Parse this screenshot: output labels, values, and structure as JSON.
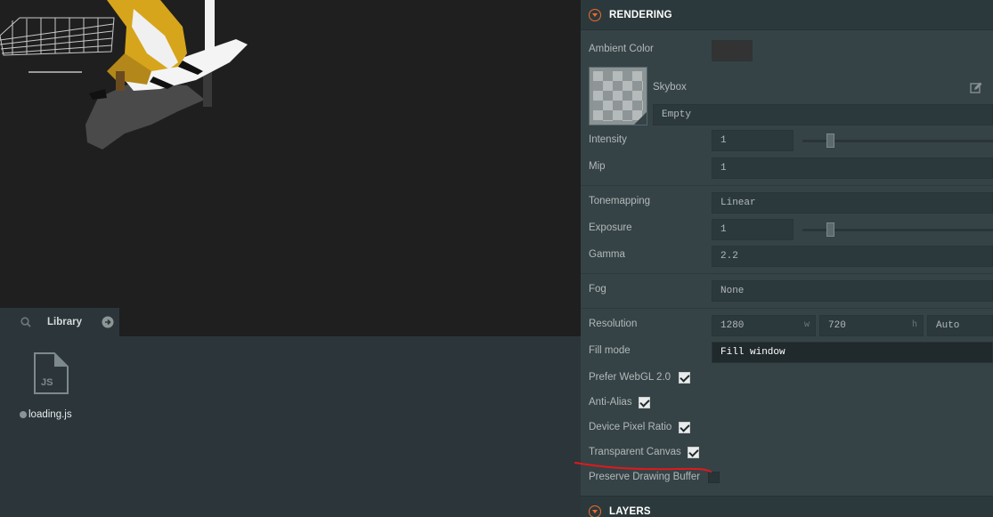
{
  "colors": {
    "accent": "#f16b2a",
    "ambient_color": "#333333",
    "annotation": "#e0191c"
  },
  "library": {
    "title": "Library",
    "assets": [
      {
        "name": "loading.js",
        "type_label": "JS",
        "icon": "js-file-icon"
      }
    ]
  },
  "inspector": {
    "rendering": {
      "title": "RENDERING",
      "ambient_color_label": "Ambient Color",
      "skybox_label": "Skybox",
      "skybox_value": "Empty",
      "intensity_label": "Intensity",
      "intensity_value": "1",
      "intensity_slider": 0.14,
      "mip_label": "Mip",
      "mip_value": "1",
      "tonemapping_label": "Tonemapping",
      "tonemapping_value": "Linear",
      "exposure_label": "Exposure",
      "exposure_value": "1",
      "exposure_slider": 0.14,
      "gamma_label": "Gamma",
      "gamma_value": "2.2",
      "fog_label": "Fog",
      "fog_value": "None",
      "resolution_label": "Resolution",
      "resolution_width": "1280",
      "resolution_width_suffix": "w",
      "resolution_height": "720",
      "resolution_height_suffix": "h",
      "resolution_mode": "Auto",
      "fill_mode_label": "Fill mode",
      "fill_mode_value": "Fill window",
      "prefer_webgl2_label": "Prefer WebGL 2.0",
      "prefer_webgl2": true,
      "anti_alias_label": "Anti-Alias",
      "anti_alias": true,
      "device_pixel_ratio_label": "Device Pixel Ratio",
      "device_pixel_ratio": true,
      "transparent_canvas_label": "Transparent Canvas",
      "transparent_canvas": true,
      "preserve_drawing_buffer_label": "Preserve Drawing Buffer",
      "preserve_drawing_buffer": false
    },
    "layers": {
      "title": "LAYERS"
    }
  }
}
